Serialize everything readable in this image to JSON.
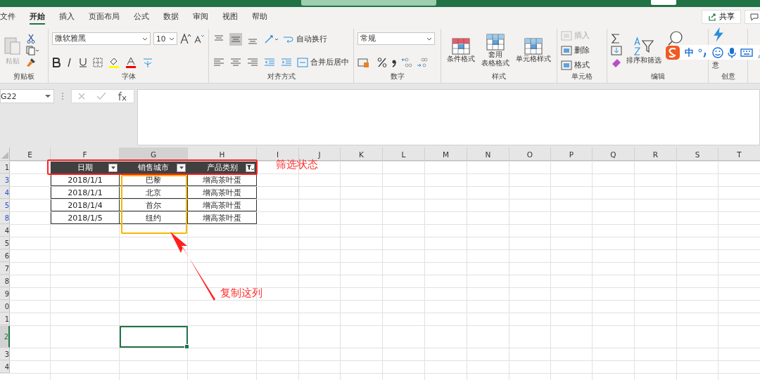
{
  "menu_tabs": [
    {
      "label": "文件",
      "selected": false
    },
    {
      "label": "开始",
      "selected": true
    },
    {
      "label": "插入",
      "selected": false
    },
    {
      "label": "页面布局",
      "selected": false
    },
    {
      "label": "公式",
      "selected": false
    },
    {
      "label": "数据",
      "selected": false
    },
    {
      "label": "审阅",
      "selected": false
    },
    {
      "label": "视图",
      "selected": false
    },
    {
      "label": "帮助",
      "selected": false
    }
  ],
  "share_button": "共享",
  "ribbon": {
    "clipboard": {
      "paste": "粘贴",
      "label": "剪贴板"
    },
    "font": {
      "name": "微软雅黑",
      "size": "10",
      "label": "字体"
    },
    "alignment": {
      "wrap": "自动换行",
      "merge": "合并后居中",
      "label": "对齐方式"
    },
    "number": {
      "format": "常规",
      "label": "数字"
    },
    "styles": {
      "items": [
        {
          "lines": [
            "条件格式"
          ]
        },
        {
          "lines": [
            "套用",
            "表格格式"
          ]
        },
        {
          "lines": [
            "单元格样式"
          ]
        }
      ],
      "label": "样式"
    },
    "cells": {
      "items": [
        {
          "label": "插入",
          "disabled": true
        },
        {
          "label": "删除",
          "disabled": false
        },
        {
          "label": "格式",
          "disabled": false
        }
      ],
      "label": "单元格"
    },
    "editing": {
      "sort": "排序和筛选",
      "label": "编辑"
    },
    "ideas": {
      "item": "意",
      "label": "创意"
    }
  },
  "ime_toolbar": {
    "mode": "中"
  },
  "name_box": "G22",
  "sheet": {
    "columns": [
      {
        "label": "E",
        "selected": false
      },
      {
        "label": "F",
        "selected": false
      },
      {
        "label": "G",
        "selected": true
      },
      {
        "label": "H",
        "selected": false
      },
      {
        "label": "I",
        "selected": false
      },
      {
        "label": "J",
        "selected": false
      },
      {
        "label": "K",
        "selected": false
      },
      {
        "label": "L",
        "selected": false
      },
      {
        "label": "M",
        "selected": false
      },
      {
        "label": "N",
        "selected": false
      },
      {
        "label": "O",
        "selected": false
      },
      {
        "label": "P",
        "selected": false
      },
      {
        "label": "Q",
        "selected": false
      },
      {
        "label": "R",
        "selected": false
      },
      {
        "label": "S",
        "selected": false
      },
      {
        "label": "T",
        "selected": false
      }
    ],
    "rows": [
      {
        "label": "1",
        "filtered": false,
        "selected": false,
        "tall": false
      },
      {
        "label": "3",
        "filtered": true,
        "selected": false,
        "tall": false
      },
      {
        "label": "4",
        "filtered": true,
        "selected": false,
        "tall": false
      },
      {
        "label": "5",
        "filtered": true,
        "selected": false,
        "tall": false
      },
      {
        "label": "8",
        "filtered": true,
        "selected": false,
        "tall": false
      },
      {
        "label": "4",
        "filtered": false,
        "selected": false,
        "tall": false
      },
      {
        "label": "5",
        "filtered": false,
        "selected": false,
        "tall": false
      },
      {
        "label": "6",
        "filtered": false,
        "selected": false,
        "tall": false
      },
      {
        "label": "7",
        "filtered": false,
        "selected": false,
        "tall": false
      },
      {
        "label": "8",
        "filtered": false,
        "selected": false,
        "tall": false
      },
      {
        "label": "9",
        "filtered": false,
        "selected": false,
        "tall": false
      },
      {
        "label": "0",
        "filtered": false,
        "selected": false,
        "tall": false
      },
      {
        "label": "1",
        "filtered": false,
        "selected": false,
        "tall": false
      },
      {
        "label": "2",
        "filtered": false,
        "selected": true,
        "tall": true
      },
      {
        "label": "3",
        "filtered": false,
        "selected": false,
        "tall": false
      },
      {
        "label": "4",
        "filtered": false,
        "selected": false,
        "tall": false
      }
    ]
  },
  "table": {
    "headers": [
      {
        "label": "日期",
        "filter_active": false
      },
      {
        "label": "销售城市",
        "filter_active": false
      },
      {
        "label": "产品类别",
        "filter_active": true
      }
    ],
    "rows": [
      [
        "2018/1/1",
        "巴黎",
        "增高茶叶蛋"
      ],
      [
        "2018/1/1",
        "北京",
        "增高茶叶蛋"
      ],
      [
        "2018/1/4",
        "首尔",
        "增高茶叶蛋"
      ],
      [
        "2018/1/5",
        "纽约",
        "增高茶叶蛋"
      ]
    ]
  },
  "annotations": {
    "filter_note": "筛选状态",
    "copy_note": "复制这列"
  }
}
